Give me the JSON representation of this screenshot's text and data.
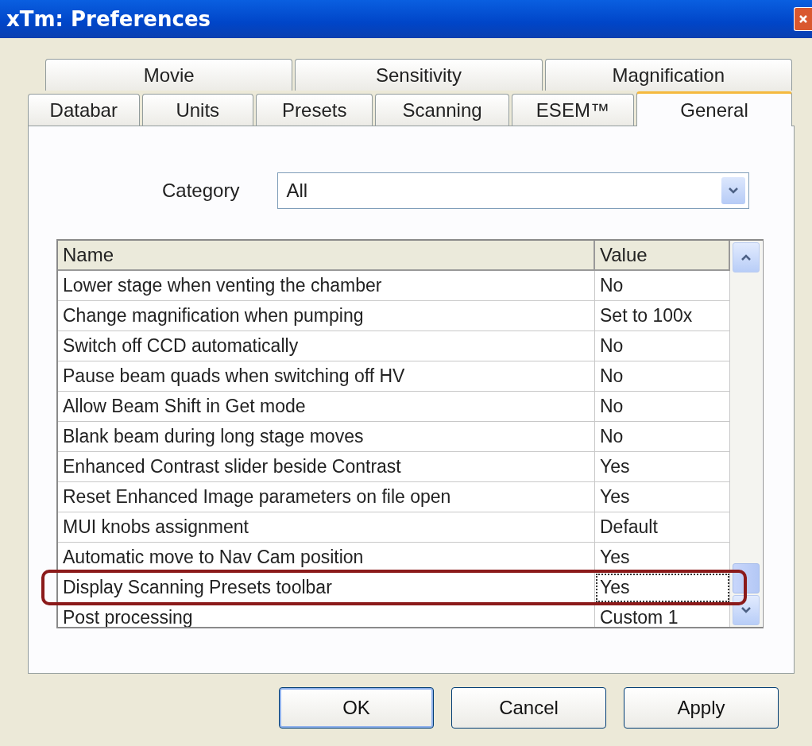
{
  "window": {
    "title": "xTm: Preferences"
  },
  "tab_rows": [
    [
      {
        "label": "Movie",
        "selected": false
      },
      {
        "label": "Sensitivity",
        "selected": false
      },
      {
        "label": "Magnification",
        "selected": false
      }
    ],
    [
      {
        "label": "Databar",
        "selected": false
      },
      {
        "label": "Units",
        "selected": false
      },
      {
        "label": "Presets",
        "selected": false
      },
      {
        "label": "Scanning",
        "selected": false
      },
      {
        "label": "ESEM™",
        "selected": false
      },
      {
        "label": "General",
        "selected": true
      }
    ]
  ],
  "category": {
    "label": "Category",
    "value": "All"
  },
  "table": {
    "columns": [
      "Name",
      "Value"
    ],
    "rows": [
      {
        "name": "Lower stage when venting the chamber",
        "value": "No",
        "focused": false
      },
      {
        "name": "Change magnification when pumping",
        "value": "Set to 100x",
        "focused": false
      },
      {
        "name": "Switch off CCD automatically",
        "value": "No",
        "focused": false
      },
      {
        "name": "Pause beam quads when switching off HV",
        "value": "No",
        "focused": false
      },
      {
        "name": "Allow Beam Shift in Get mode",
        "value": "No",
        "focused": false
      },
      {
        "name": "Blank beam during long stage moves",
        "value": "No",
        "focused": false
      },
      {
        "name": "Enhanced Contrast slider beside Contrast",
        "value": "Yes",
        "focused": false
      },
      {
        "name": "Reset Enhanced Image parameters on file open",
        "value": "Yes",
        "focused": false
      },
      {
        "name": "MUI knobs assignment",
        "value": "Default",
        "focused": false
      },
      {
        "name": "Automatic move to Nav Cam position",
        "value": "Yes",
        "focused": false
      },
      {
        "name": "Display Scanning Presets toolbar",
        "value": "Yes",
        "focused": true
      },
      {
        "name": "Post processing",
        "value": "Custom 1",
        "focused": false
      }
    ]
  },
  "buttons": [
    "OK",
    "Cancel",
    "Apply"
  ]
}
